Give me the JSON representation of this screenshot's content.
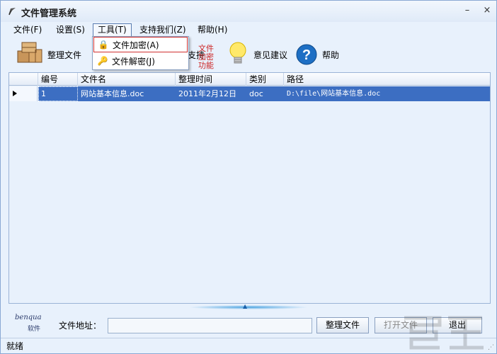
{
  "window": {
    "title": "文件管理系统",
    "minimize": "–",
    "close": "×"
  },
  "menu": {
    "items": [
      {
        "label": "文件(F)"
      },
      {
        "label": "设置(S)"
      },
      {
        "label": "工具(T)"
      },
      {
        "label": "支持我们(Z)"
      },
      {
        "label": "帮助(H)"
      }
    ]
  },
  "toolbar": {
    "organize": "整理文件",
    "feedback": "意见建议",
    "help": "帮助",
    "partial": "支持"
  },
  "dropdown": {
    "encrypt": "文件加密(A)",
    "decrypt": "文件解密(J)"
  },
  "annotation": "文件加密功能",
  "grid": {
    "columns": [
      "编号",
      "文件名",
      "整理时间",
      "类别",
      "路径"
    ],
    "rows": [
      {
        "id": "1",
        "name": "网站基本信息.doc",
        "time": "2011年2月12日",
        "type": "doc",
        "path": "D:\\file\\网站基本信息.doc"
      }
    ]
  },
  "bottom": {
    "logo_top": "benqua",
    "logo_bottom": "软件",
    "address_label": "文件地址：",
    "address_value": "",
    "organize_button": "整理文件",
    "open_button": "打开文件",
    "exit_button": "退出"
  },
  "status": {
    "text": "就绪"
  },
  "icons": {
    "app": "app-icon",
    "organize": "boxes-icon",
    "feedback": "lightbulb-icon",
    "help": "question-icon",
    "encrypt": "lock-icon",
    "decrypt": "key-icon"
  },
  "colors": {
    "selection": "#3c6ec2",
    "window_bg": "#e8f1fc",
    "highlight_border": "#d03030"
  }
}
